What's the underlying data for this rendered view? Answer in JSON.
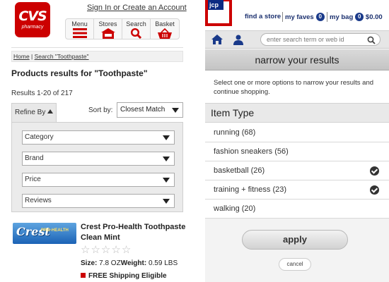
{
  "cvs": {
    "logo": {
      "main": "CVS",
      "sub": "pharmacy"
    },
    "signin_link": "Sign In or Create an Account",
    "nav": [
      {
        "label": "Menu",
        "icon": "hamburger-icon"
      },
      {
        "label": "Stores",
        "icon": "store-icon"
      },
      {
        "label": "Search",
        "icon": "search-icon"
      },
      {
        "label": "Basket",
        "icon": "basket-icon"
      }
    ],
    "breadcrumb": {
      "home": "Home",
      "separator": " | ",
      "current": "Search \"Toothpaste\""
    },
    "title": "Products results for \"Toothpaste\"",
    "results_count": "Results 1-20 of 217",
    "refine_label": "Refine By",
    "sort": {
      "label": "Sort by:",
      "value": "Closest Match"
    },
    "filters": [
      "Category",
      "Brand",
      "Price",
      "Reviews"
    ],
    "product": {
      "image_text": "Crest",
      "image_sub": "PRO-HEALTH",
      "name": "Crest Pro-Health Toothpaste Clean Mint",
      "rating_stars": 5,
      "rating_value": 0,
      "size_label": "Size:",
      "size_value": "7.8 OZ",
      "weight_label": "Weight:",
      "weight_value": "0.59 LBS",
      "shipping": "FREE Shipping Eligible"
    },
    "colors": {
      "brand_red": "#cc0000"
    }
  },
  "jcp": {
    "logo": "jcp",
    "top_links": {
      "find_store": "find a store",
      "faves_label": "my faves",
      "faves_count": "0",
      "bag_label": "my bag",
      "bag_count": "0",
      "bag_total": "$0.00"
    },
    "search_placeholder": "enter search term or web id",
    "narrow_title": "narrow your results",
    "instructions": "Select one or more options to narrow your results and continue shopping.",
    "section_title": "Item Type",
    "options": [
      {
        "label": "running (68)",
        "checked": false
      },
      {
        "label": "fashion sneakers (56)",
        "checked": false
      },
      {
        "label": "basketball (26)",
        "checked": true
      },
      {
        "label": "training + fitness (23)",
        "checked": true
      },
      {
        "label": "walking (20)",
        "checked": false
      }
    ],
    "apply_label": "apply",
    "cancel_label": "cancel",
    "colors": {
      "brand_red": "#cc0000",
      "brand_navy": "#1a2f6e"
    }
  }
}
